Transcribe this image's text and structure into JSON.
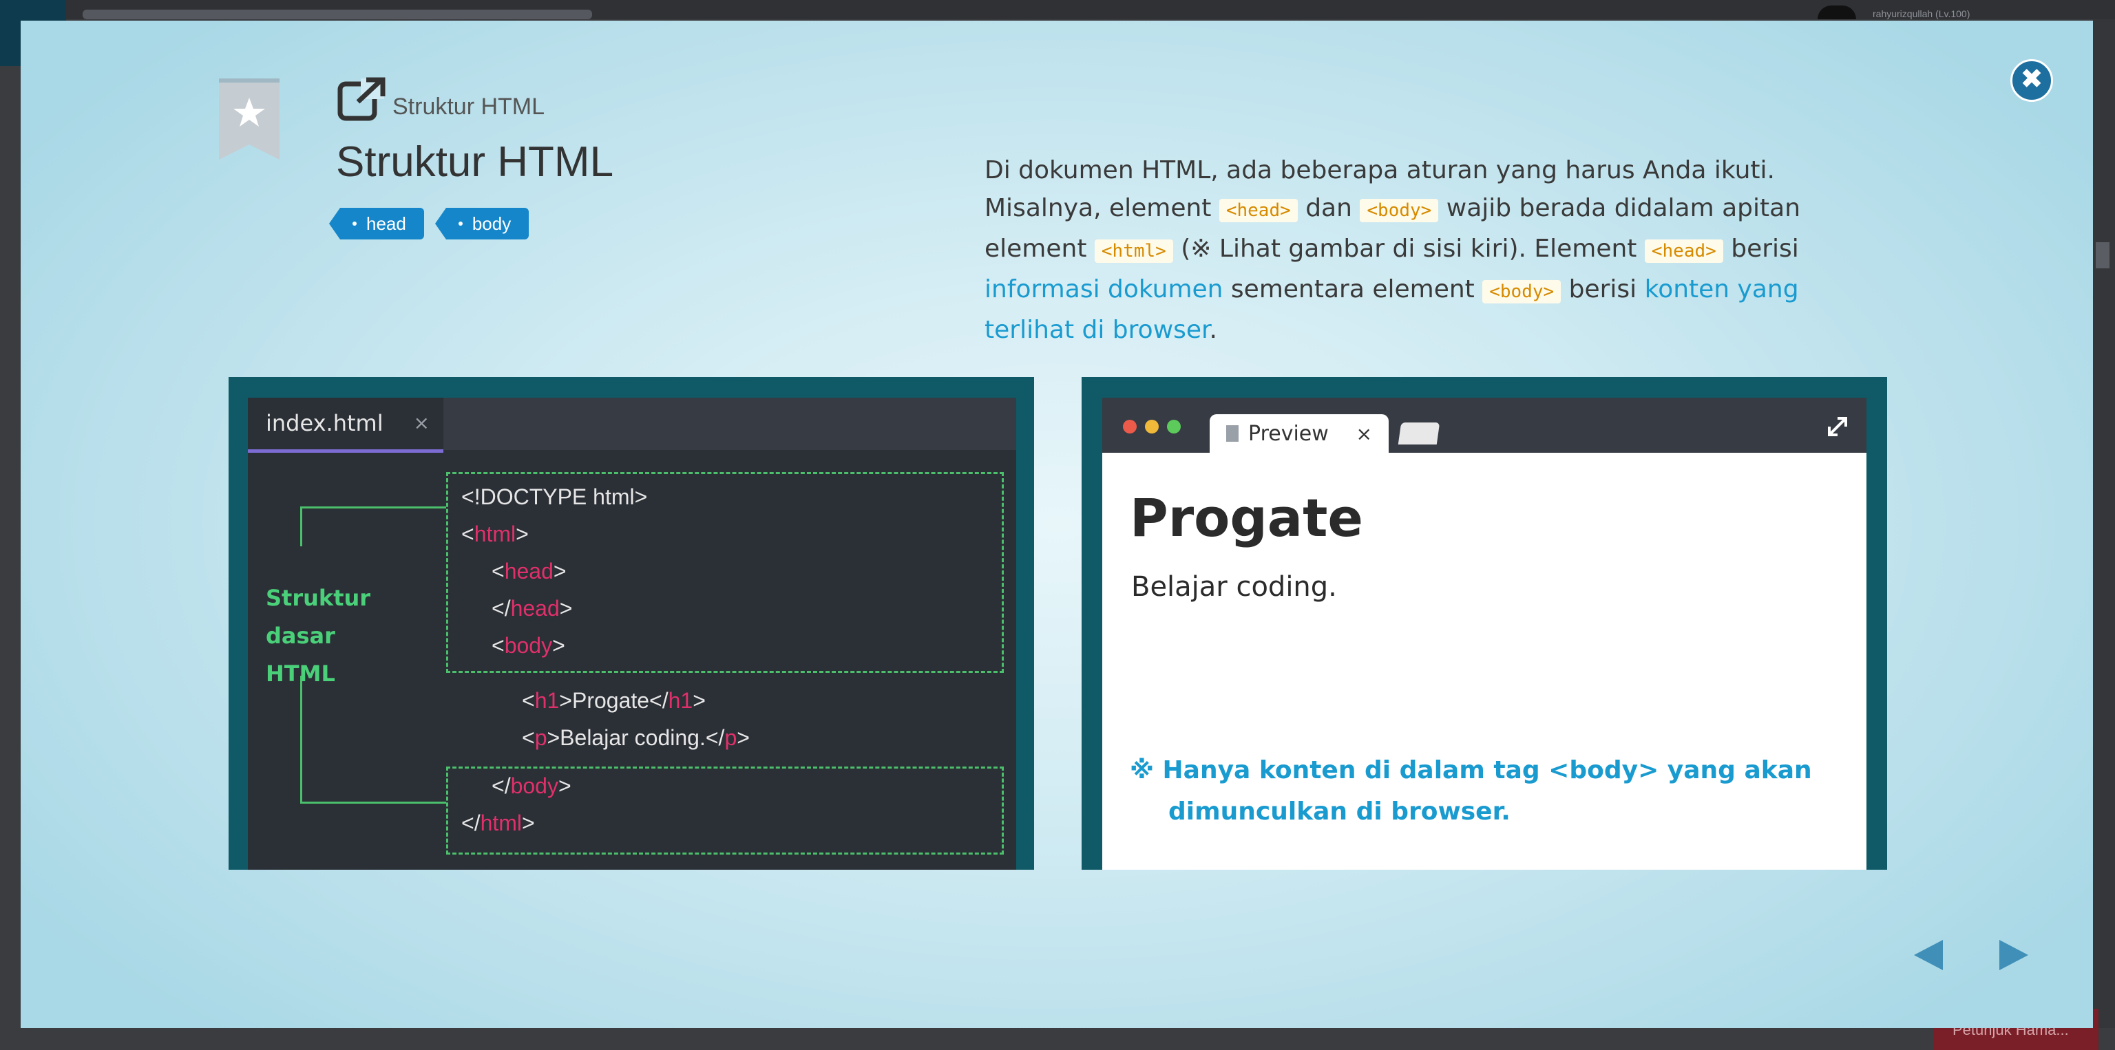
{
  "background": {
    "username": "rahyurizqullah (Lv.100)",
    "hint_button": "Petunjuk Hama..."
  },
  "modal": {
    "subtitle": "Struktur HTML",
    "title": "Struktur HTML",
    "tags": [
      "head",
      "body"
    ],
    "description": {
      "t1": "Di dokumen HTML, ada beberapa aturan yang harus Anda ikuti. Misalnya, element ",
      "c1": "<head>",
      "t2": " dan ",
      "c2": "<body>",
      "t3": " wajib berada didalam apitan element ",
      "c3": "<html>",
      "t4": " (※ Lihat gambar di sisi kiri). Element ",
      "c4": "<head>",
      "t5": " berisi ",
      "l1": "informasi dokumen",
      "t6": " sementara element ",
      "c5": "<body>",
      "t7": " berisi ",
      "l2": "konten yang terlihat di browser",
      "t8": "."
    },
    "editor": {
      "tab_label": "index.html",
      "tab_close": "×",
      "structure_label_1": "Struktur dasar",
      "structure_label_2": "HTML",
      "lines": {
        "doctype": "<!DOCTYPE html>",
        "html_open_tag": "html",
        "head_tag": "head",
        "body_tag": "body",
        "h1_tag": "h1",
        "h1_text": "Progate",
        "p_tag": "p",
        "p_text": "Belajar coding."
      }
    },
    "preview": {
      "tab_label": "Preview",
      "tab_close": "×",
      "heading": "Progate",
      "paragraph": "Belajar coding.",
      "note": "※ Hanya konten di dalam tag <body> yang akan dimunculkan di browser."
    },
    "colors": {
      "accent_blue": "#1486c9",
      "tag_pink": "#e0306a",
      "guide_green": "#4bbf6b",
      "link_blue": "#1a9bd0",
      "panel_teal": "#0f5a66"
    },
    "icons": [
      "close-icon",
      "bookmark-star-icon",
      "external-link-icon",
      "prev-arrow-icon",
      "next-arrow-icon",
      "expand-icon"
    ]
  }
}
